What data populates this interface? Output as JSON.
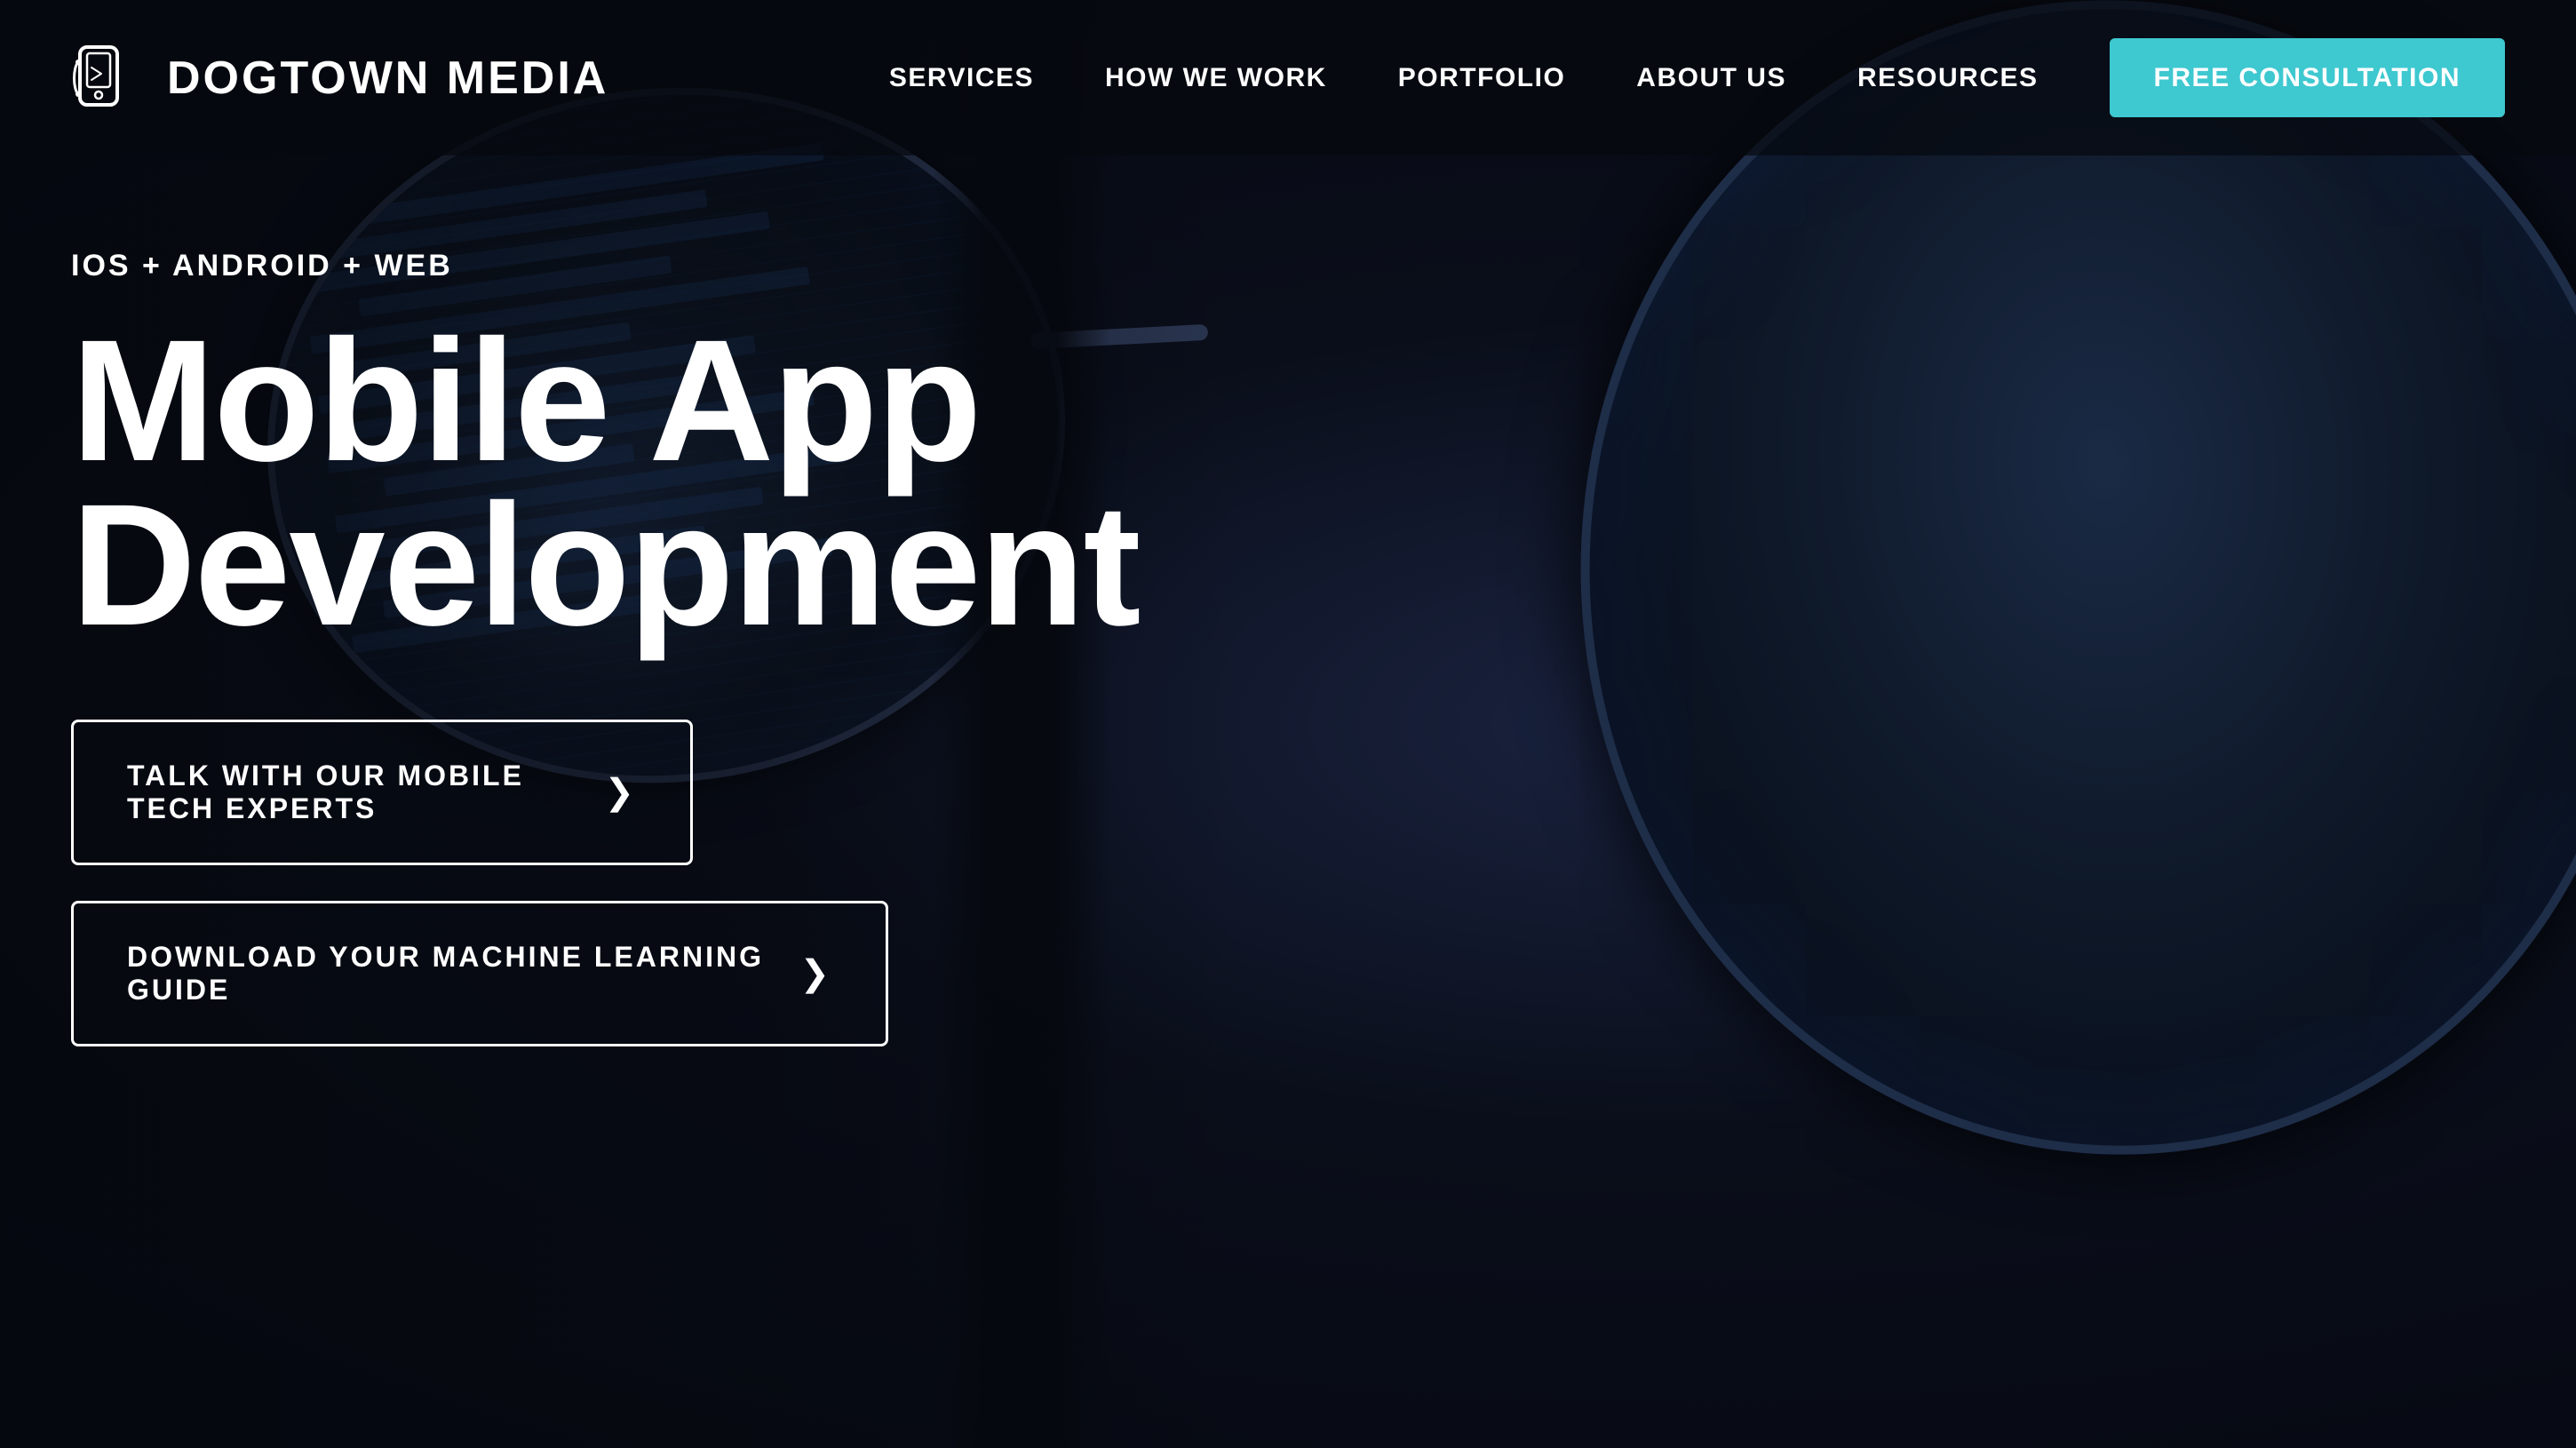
{
  "brand": {
    "name": "DOGTOWN MEDIA",
    "logo_alt": "Dogtown Media logo"
  },
  "nav": {
    "links": [
      {
        "id": "services",
        "label": "SERVICES"
      },
      {
        "id": "how-we-work",
        "label": "HOW WE WORK"
      },
      {
        "id": "portfolio",
        "label": "PORTFOLIO"
      },
      {
        "id": "about-us",
        "label": "ABOUT US"
      },
      {
        "id": "resources",
        "label": "RESOURCES"
      }
    ],
    "cta_label": "FREE CONSULTATION"
  },
  "hero": {
    "subtitle": "IOS + ANDROID + WEB",
    "title_line1": "Mobile App",
    "title_line2": "Development",
    "btn_primary_label": "TALK WITH OUR MOBILE TECH EXPERTS",
    "btn_secondary_label": "DOWNLOAD YOUR MACHINE LEARNING GUIDE"
  },
  "colors": {
    "cta_bg": "#3ec8d0",
    "btn_border": "#ffffff",
    "bg_dark": "#050810"
  },
  "icons": {
    "logo": "📱",
    "chevron": "›"
  }
}
